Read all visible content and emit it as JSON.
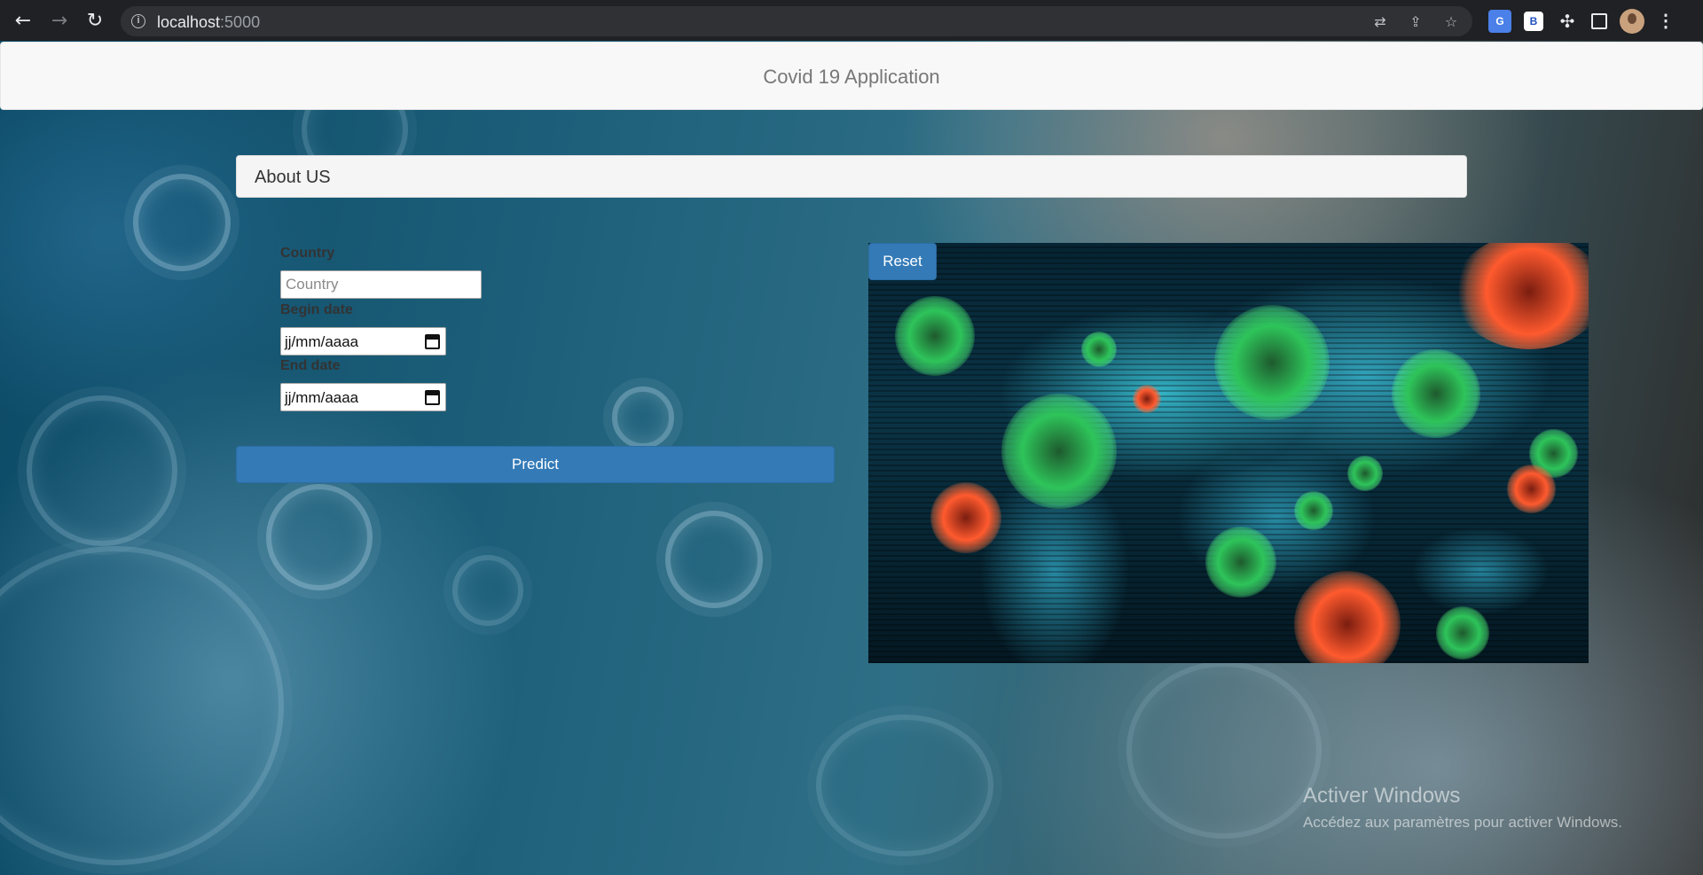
{
  "browser": {
    "url_host": "localhost",
    "url_port": ":5000",
    "back_icon": "arrow-left-icon",
    "forward_icon": "arrow-right-icon",
    "reload_icon": "reload-icon"
  },
  "navbar": {
    "brand": "Covid 19 Application"
  },
  "panel": {
    "title": "About US"
  },
  "form": {
    "country_label": "Country",
    "country_placeholder": "Country",
    "begin_label": "Begin date",
    "begin_value": "jj/mm/aaaa",
    "end_label": "End date",
    "end_value": "jj/mm/aaaa",
    "predict_label": "Predict"
  },
  "image": {
    "reset_label": "Reset"
  },
  "watermark": {
    "title": "Activer Windows",
    "subtitle": "Accédez aux paramètres pour activer Windows."
  },
  "colors": {
    "primary": "#337ab7",
    "navbar_bg": "#f8f8f8",
    "panel_bg": "#f5f5f5"
  }
}
